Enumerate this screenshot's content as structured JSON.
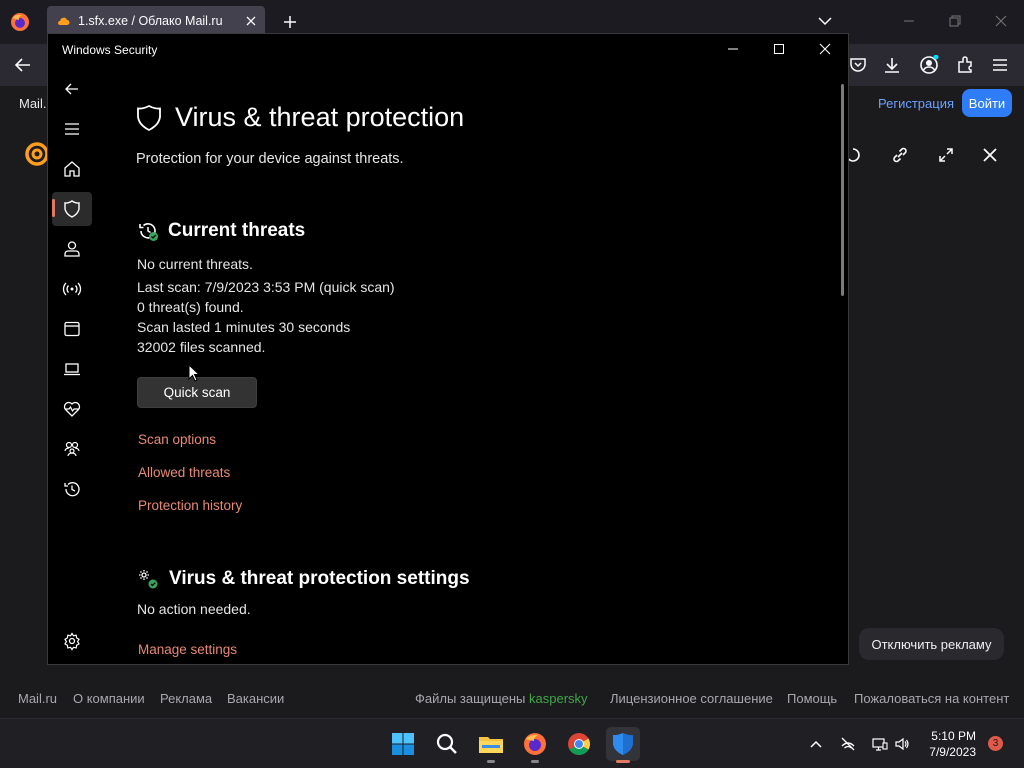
{
  "browser": {
    "tab_title": "1.sfx.exe / Облако Mail.ru",
    "toolbar_icons": [
      "pocket-icon",
      "download-icon",
      "account-icon",
      "extensions-icon",
      "menu-icon"
    ]
  },
  "page": {
    "brand_label": "Mail.",
    "register_label": "Регистрация",
    "login_label": "Войти",
    "disable_ads_label": "Отключить рекламу",
    "footer_left": [
      "Mail.ru",
      "О компании",
      "Реклама",
      "Вакансии"
    ],
    "footer_protected_prefix": "Файлы защищены",
    "footer_protected_brand": "kaspersky",
    "footer_right": [
      "Лицензионное соглашение",
      "Помощь",
      "Пожаловаться на контент"
    ],
    "colors": {
      "link": "#6ba1ff",
      "login_button": "#2e7cf6",
      "kaspersky": "#3fa64a"
    }
  },
  "security_window": {
    "title": "Windows Security",
    "sidebar": [
      "back-icon",
      "hamburger-icon",
      "home-icon",
      "shield-icon",
      "account-icon",
      "network-icon",
      "app-browser-icon",
      "device-security-icon",
      "health-icon",
      "family-icon",
      "history-icon",
      "settings-icon"
    ],
    "selected_sidebar": "shield-icon",
    "page_title": "Virus & threat protection",
    "page_subtitle": "Protection for your device against threats.",
    "current_threats": {
      "heading": "Current threats",
      "lines": [
        "No current threats.",
        "Last scan: 7/9/2023 3:53 PM (quick scan)",
        "0 threat(s) found.",
        "Scan lasted 1 minutes 30 seconds",
        "32002 files scanned."
      ],
      "quick_scan_label": "Quick scan",
      "links": [
        "Scan options",
        "Allowed threats",
        "Protection history"
      ]
    },
    "settings_section": {
      "heading": "Virus & threat protection settings",
      "status": "No action needed.",
      "link": "Manage settings"
    },
    "colors": {
      "accent_link": "#e88a74",
      "background": "#000000"
    }
  },
  "taskbar": {
    "apps": [
      "windows-start-icon",
      "search-icon",
      "file-explorer-icon",
      "firefox-icon",
      "chrome-icon",
      "windows-security-icon"
    ],
    "time": "5:10 PM",
    "date": "7/9/2023",
    "notification_count": "3"
  }
}
